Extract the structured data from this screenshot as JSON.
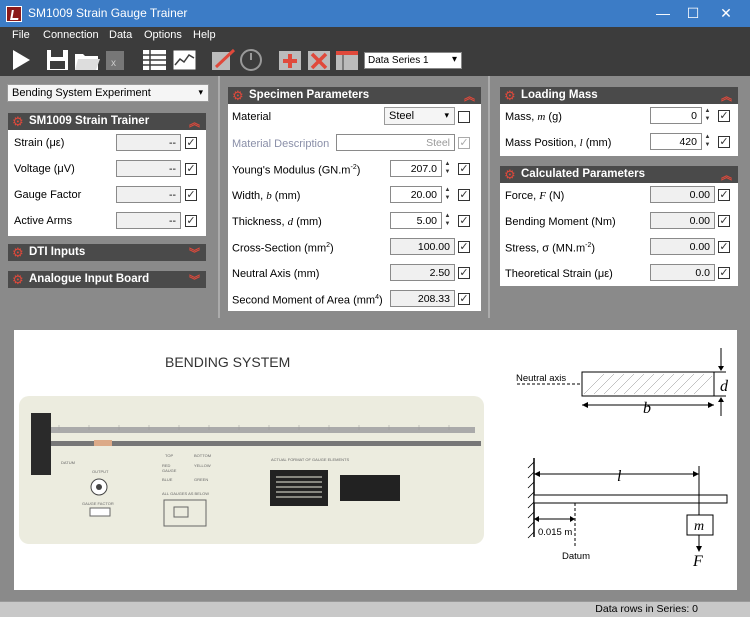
{
  "window": {
    "title": "SM1009 Strain Gauge Trainer",
    "minimize": "—",
    "maximize": "☐",
    "close": "✕"
  },
  "menu": [
    "File",
    "Connection",
    "Data",
    "Options",
    "Help"
  ],
  "toolbar": {
    "series_select": "Data Series 1",
    "icons": [
      "play-icon",
      "save-icon",
      "open-folder-icon",
      "export-icon",
      "table-icon",
      "chart-icon",
      "edit-icon",
      "clock-icon",
      "add-row-icon",
      "delete-row-icon",
      "clear-table-icon"
    ]
  },
  "experiment_select": "Bending System Experiment",
  "trainer": {
    "title": "SM1009 Strain Trainer",
    "rows": [
      {
        "label": "Strain  (με)",
        "value": "--"
      },
      {
        "label": "Voltage  (μV)",
        "value": "--"
      },
      {
        "label": "Gauge Factor",
        "value": "--"
      },
      {
        "label": "Active Arms",
        "value": "--"
      }
    ]
  },
  "dti_title": "DTI Inputs",
  "analogue_title": "Analogue Input Board",
  "specimen": {
    "title": "Specimen Parameters",
    "material_label": "Material",
    "material_value": "Steel",
    "material_desc_label": "Material Description",
    "material_desc_value": "Steel",
    "youngs_label": "Young's Modulus  (GN.m",
    "youngs_sup": "-2",
    "youngs_tail": ")",
    "youngs_value": "207.0",
    "width_label": "Width, ",
    "width_sym": "b",
    "width_unit": "  (mm)",
    "width_value": "20.00",
    "thickness_label": "Thickness, ",
    "thickness_sym": "d",
    "thickness_unit": "  (mm)",
    "thickness_value": "5.00",
    "cross_label": "Cross-Section  (mm",
    "cross_sup": "2",
    "cross_tail": ")",
    "cross_value": "100.00",
    "neutral_label": "Neutral Axis  (mm)",
    "neutral_value": "2.50",
    "second_label": "Second Moment of Area  (mm",
    "second_sup": "4",
    "second_tail": ")",
    "second_value": "208.33"
  },
  "loading": {
    "title": "Loading Mass",
    "mass_label": "Mass, ",
    "mass_sym": "m",
    "mass_unit": "  (g)",
    "mass_value": "0",
    "pos_label": "Mass Position, ",
    "pos_sym": "l",
    "pos_unit": "  (mm)",
    "pos_value": "420"
  },
  "calculated": {
    "title": "Calculated Parameters",
    "force_label": "Force, ",
    "force_sym": "F",
    "force_unit": "  (N)",
    "force_value": "0.00",
    "moment_label": "Bending Moment  (Nm)",
    "moment_value": "0.00",
    "stress_label": "Stress, σ  (MN.m",
    "stress_sup": "-2",
    "stress_tail": ")",
    "stress_value": "0.00",
    "strain_label": "Theoretical Strain  (με)",
    "strain_value": "0.0"
  },
  "diagram": {
    "heading": "BENDING SYSTEM",
    "neutral_axis": "Neutral axis",
    "d": "d",
    "b": "b",
    "l": "l",
    "m": "m",
    "F": "F",
    "offset": "0.015 m",
    "datum": "Datum",
    "photo_labels": {
      "datum": "DATUM",
      "output": "OUTPUT",
      "gauge_factor": "GAUGE FACTOR",
      "top": "TOP",
      "bottom": "BOTTOM",
      "red": "RED",
      "yellow": "YELLOW",
      "gauge": "GAUGE",
      "blue": "BLUE",
      "green": "GREEN",
      "all_gauges": "ALL GAUGES AS BELOW",
      "actual_format": "ACTUAL FORMAT OF GAUGE ELEMENTS"
    }
  },
  "status": "Data rows in Series: 0",
  "colors": {
    "accent": "#e0493b",
    "titlebar": "#3c7cc6",
    "dark": "#3c3c3c"
  }
}
